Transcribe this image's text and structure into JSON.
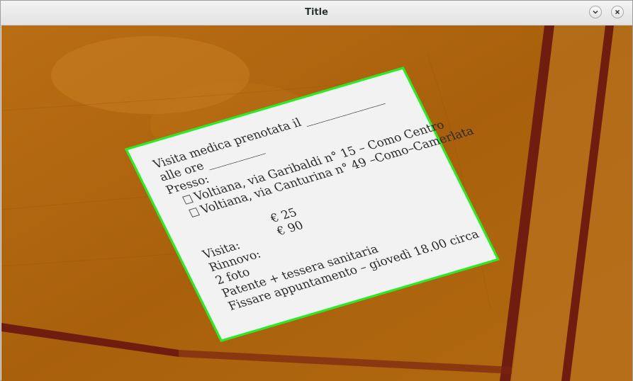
{
  "window": {
    "title": "Title"
  },
  "titlebar": {
    "minimize_icon": "chevron-down-icon",
    "close_icon": "close-icon"
  },
  "colors": {
    "wood": "#b4690d",
    "inlay": "#6e1d0f",
    "detection_outline": "#22ee22",
    "paper": "#f2f2f2"
  },
  "card": {
    "line1": "Visita medica prenotata il ______________",
    "line2": "alle ore __________",
    "line3": "Presso:",
    "option1": "Voltiana, via Garibaldi n° 15 – Como Centro",
    "option2": "Voltiana, via Canturina n° 49 –Como–Camerlata",
    "visita_label": "Visita:",
    "visita_price": "€ 25",
    "rinnovo_label": "Rinnovo:",
    "rinnovo_price": "€ 90",
    "foto": "2 foto",
    "documents": "Patente + tessera sanitaria",
    "appointment": "Fissare appuntamento – giovedì 18.00 circa"
  }
}
